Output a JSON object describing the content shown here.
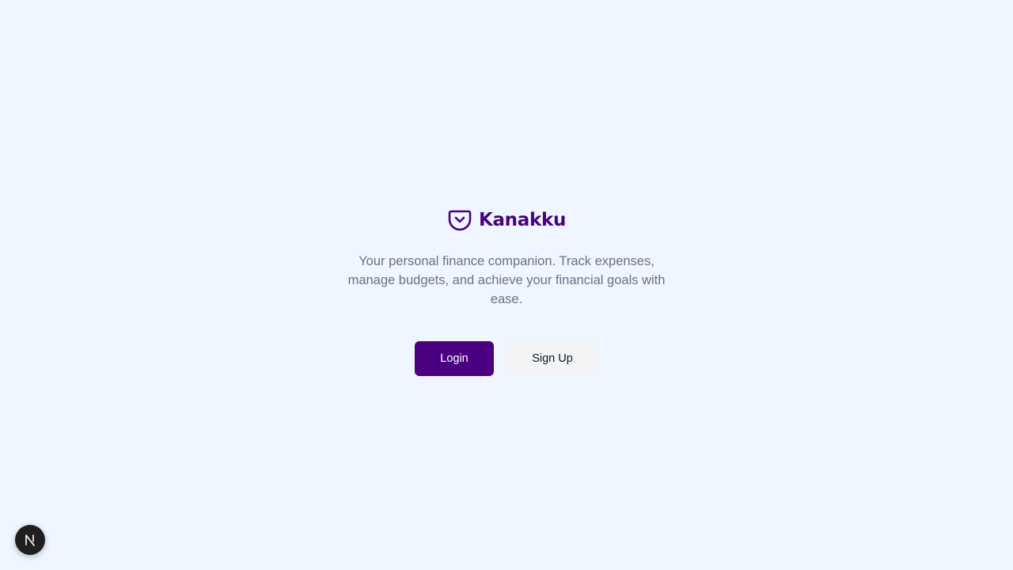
{
  "brand": {
    "name": "Kanakku",
    "icon": "pocket-icon",
    "color": "#4b0082"
  },
  "hero": {
    "tagline": "Your personal finance companion. Track expenses, manage budgets, and achieve your financial goals with ease."
  },
  "actions": {
    "login_label": "Login",
    "signup_label": "Sign Up"
  },
  "dev_indicator": {
    "icon": "nextjs-logo-icon"
  },
  "colors": {
    "background": "#eff6ff",
    "primary": "#4b0082",
    "muted_text": "#6b7280",
    "secondary_button": "#f3f4f6"
  }
}
